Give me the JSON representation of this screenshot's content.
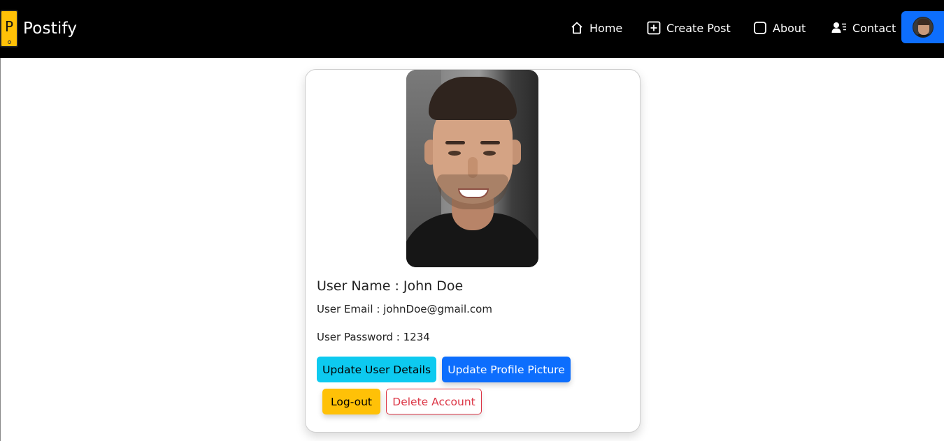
{
  "brand": {
    "logo_letter": "P",
    "name": "Postify"
  },
  "nav": {
    "items": [
      {
        "label": "Home",
        "icon": "home-icon"
      },
      {
        "label": "Create Post",
        "icon": "plus-square-icon"
      },
      {
        "label": "About",
        "icon": "square-icon"
      },
      {
        "label": "Contact",
        "icon": "person-lines-icon"
      }
    ],
    "profile_icon": "avatar-icon"
  },
  "profile": {
    "name_line": "User Name : John Doe",
    "email_line": "User Email : johnDoe@gmail.com",
    "password_line": "User Password : 1234"
  },
  "actions": {
    "update_details": "Update User Details",
    "update_picture": "Update Profile Picture",
    "logout": "Log-out",
    "delete_account": "Delete Account"
  },
  "colors": {
    "navbar": "#000000",
    "primary": "#0d6efd",
    "info": "#0dcaf0",
    "warning": "#ffc107",
    "danger": "#dc3545"
  }
}
